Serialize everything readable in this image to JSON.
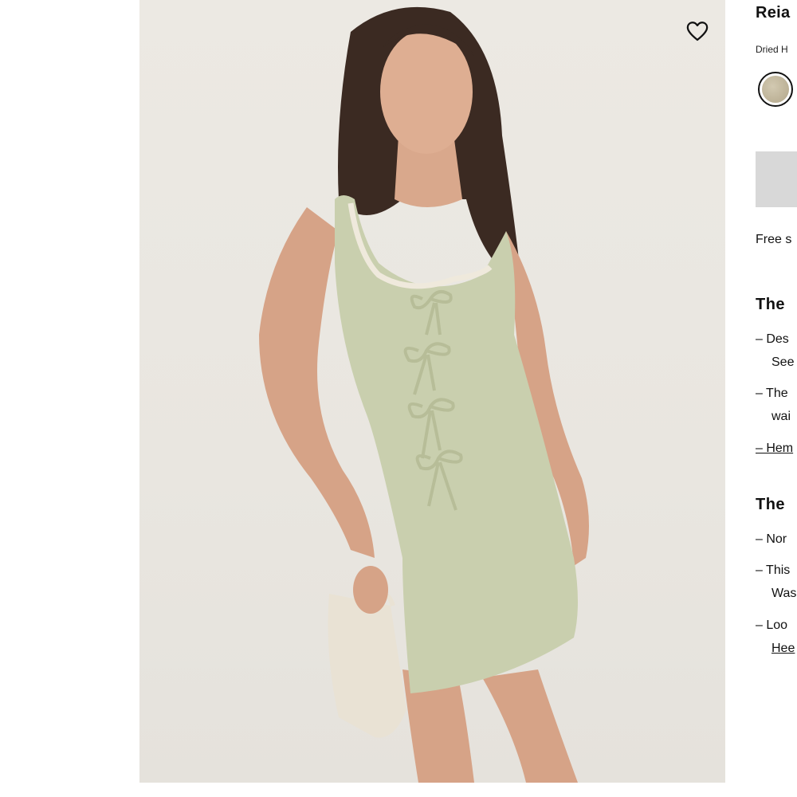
{
  "product": {
    "title": "Reia",
    "color_name": "Dried H",
    "swatch_color": "#bcb196",
    "primary_button_label": "",
    "shipping_text": "Free s"
  },
  "details": {
    "heading": "The",
    "bullets": [
      "– Des",
      "See",
      "– The",
      "wai",
      "– Hem"
    ]
  },
  "care": {
    "heading": "The",
    "bullets": [
      "– Nor",
      "– This",
      "Was",
      "– Loo",
      "Hee"
    ]
  },
  "colors": {
    "dress": "#c9cfae",
    "background": "#ebe8e2",
    "bag": "#e9e2d4"
  }
}
